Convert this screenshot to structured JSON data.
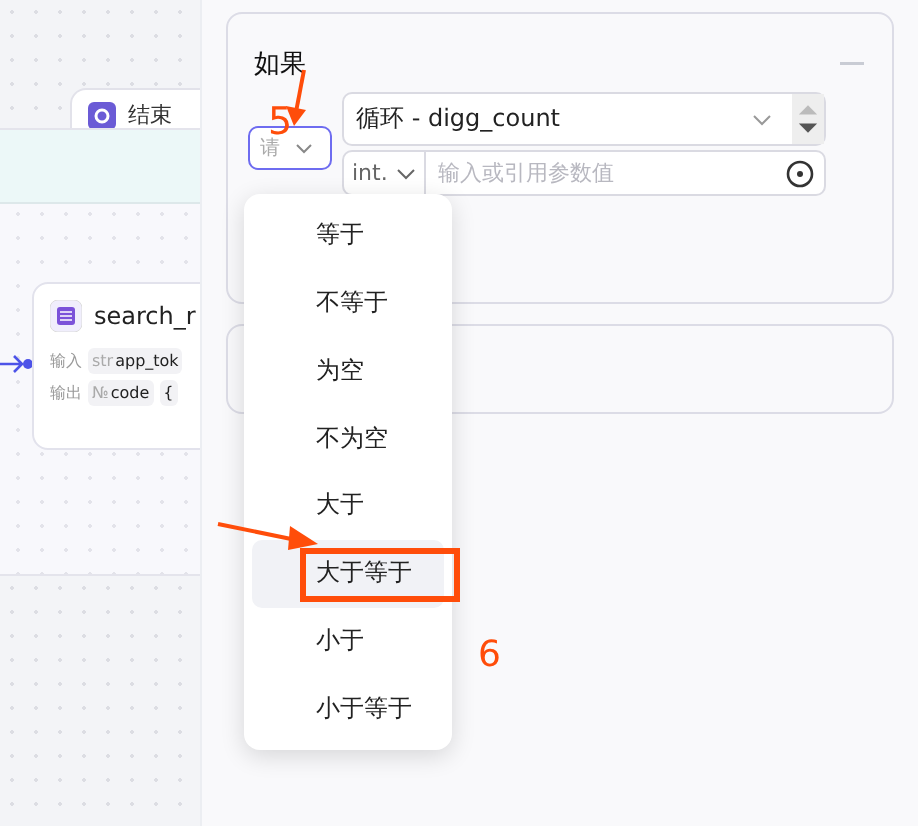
{
  "canvas": {
    "end_node": {
      "title": "结束"
    },
    "plugin_node": {
      "title": "search_r",
      "rows": [
        {
          "label": "输入",
          "tags": [
            {
              "type": "str",
              "value": "app_tok"
            }
          ]
        },
        {
          "label": "输出",
          "tags": [
            {
              "type": "№",
              "value": "code"
            },
            {
              "value": "{"
            }
          ]
        }
      ]
    }
  },
  "condition_card": {
    "title": "如果",
    "operator_select": {
      "placeholder": "请",
      "focused": true
    },
    "left_operand": {
      "value": "循环 - digg_count"
    },
    "right_operand": {
      "type": "int.",
      "placeholder": "输入或引用参数值"
    }
  },
  "operator_menu": [
    {
      "label": "等于",
      "selected": false
    },
    {
      "label": "不等于",
      "selected": false
    },
    {
      "label": "为空",
      "selected": false
    },
    {
      "label": "不为空",
      "selected": false
    },
    {
      "label": "大于",
      "selected": false
    },
    {
      "label": "大于等于",
      "selected": true
    },
    {
      "label": "小于",
      "selected": false
    },
    {
      "label": "小于等于",
      "selected": false
    }
  ],
  "annotations": [
    {
      "label": "5"
    },
    {
      "label": "6"
    }
  ]
}
